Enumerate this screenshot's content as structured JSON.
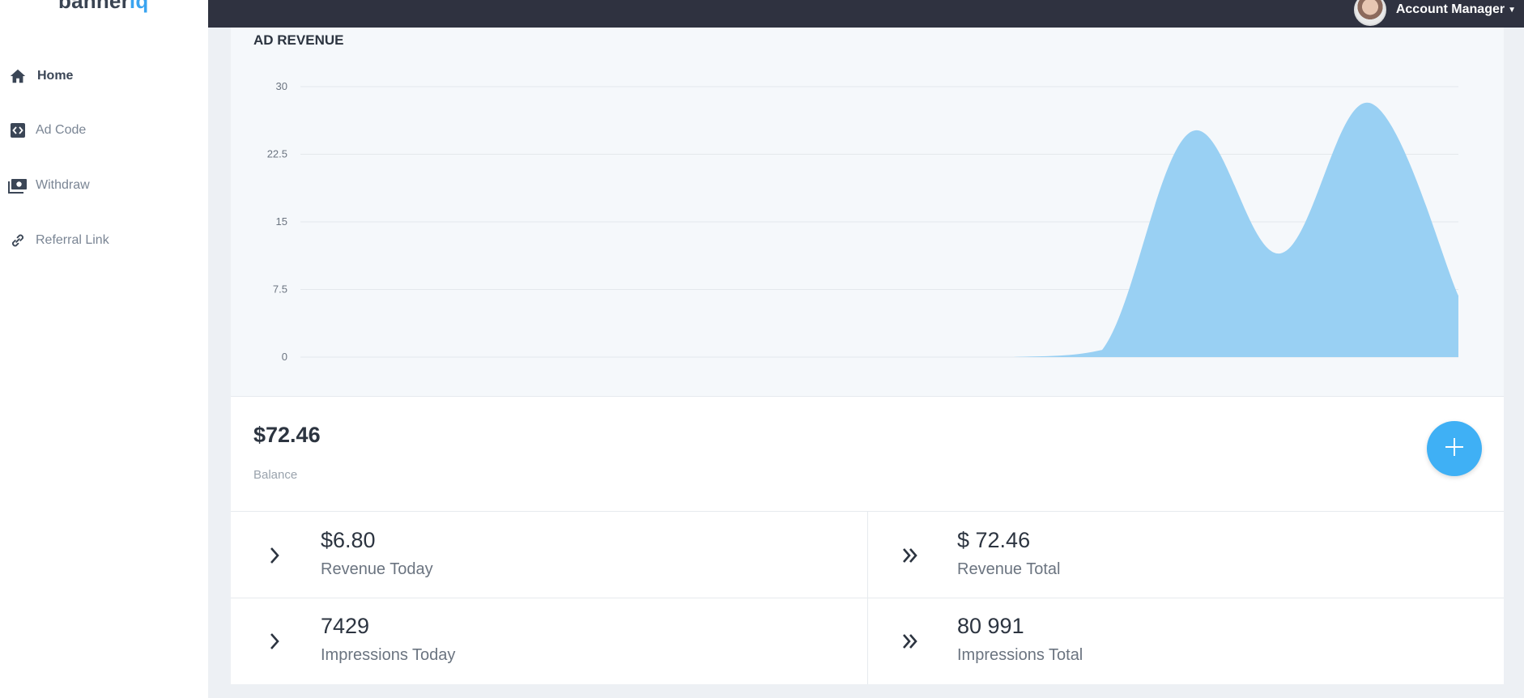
{
  "app": {
    "logo_text": "banner",
    "logo_accent": "iq"
  },
  "sidebar": {
    "items": [
      {
        "label": "Home",
        "icon": "home-icon",
        "active": true
      },
      {
        "label": "Ad Code",
        "icon": "code-icon",
        "active": false
      },
      {
        "label": "Withdraw",
        "icon": "money-icon",
        "active": false
      },
      {
        "label": "Referral Link",
        "icon": "link-icon",
        "active": false
      }
    ]
  },
  "topbar": {
    "account_label": "Account Manager"
  },
  "chart_data": {
    "type": "area",
    "title": "AD REVENUE",
    "xlabel": "",
    "ylabel": "",
    "ylim": [
      0,
      30
    ],
    "yticks": [
      "30",
      "22.5",
      "15",
      "7.5",
      "0"
    ],
    "grid": true,
    "legend": "none",
    "color": "#99d0f3",
    "x": [
      0,
      1,
      2,
      3,
      4,
      5,
      6,
      7,
      8,
      9,
      10,
      11,
      12,
      13
    ],
    "values": [
      0,
      0,
      0,
      0,
      0,
      0,
      0,
      0,
      0,
      0.8,
      25,
      11.5,
      28.2,
      6.8
    ]
  },
  "balance": {
    "value": "$72.46",
    "label": "Balance"
  },
  "stats": [
    {
      "value": "$6.80",
      "label": "Revenue Today",
      "icon": "chevron-right-icon"
    },
    {
      "value": "$ 72.46",
      "label": "Revenue Total",
      "icon": "double-chevron-right-icon"
    },
    {
      "value": "7429",
      "label": "Impressions Today",
      "icon": "chevron-right-icon"
    },
    {
      "value": "80 991",
      "label": "Impressions Total",
      "icon": "double-chevron-right-icon"
    }
  ],
  "colors": {
    "topbar": "#2f3240",
    "accent": "#3fb0f5",
    "chart_fill": "#99d0f3"
  }
}
